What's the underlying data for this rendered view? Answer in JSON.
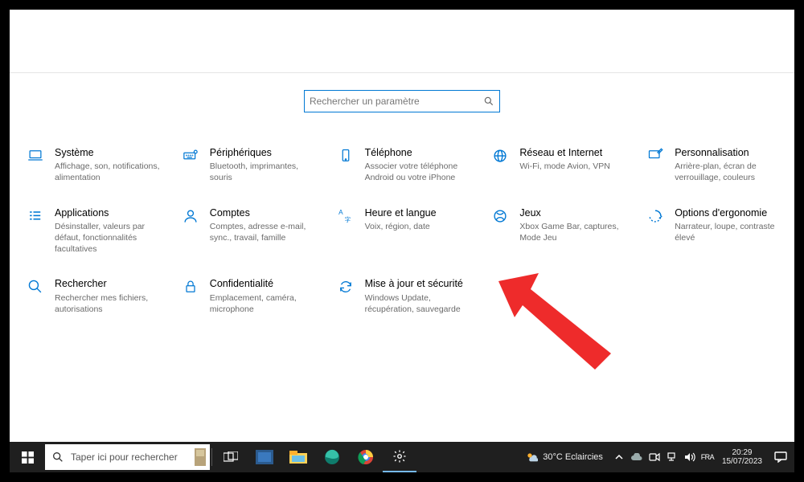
{
  "search": {
    "placeholder": "Rechercher un paramètre"
  },
  "tiles": [
    {
      "id": "system",
      "title": "Système",
      "sub": "Affichage, son, notifications, alimentation"
    },
    {
      "id": "devices",
      "title": "Périphériques",
      "sub": "Bluetooth, imprimantes, souris"
    },
    {
      "id": "phone",
      "title": "Téléphone",
      "sub": "Associer votre téléphone Android ou votre iPhone"
    },
    {
      "id": "network",
      "title": "Réseau et Internet",
      "sub": "Wi-Fi, mode Avion, VPN"
    },
    {
      "id": "personal",
      "title": "Personnalisation",
      "sub": "Arrière-plan, écran de verrouillage, couleurs"
    },
    {
      "id": "apps",
      "title": "Applications",
      "sub": "Désinstaller, valeurs par défaut, fonctionnalités facultatives"
    },
    {
      "id": "accounts",
      "title": "Comptes",
      "sub": "Comptes, adresse e-mail, sync., travail, famille"
    },
    {
      "id": "time",
      "title": "Heure et langue",
      "sub": "Voix, région, date"
    },
    {
      "id": "gaming",
      "title": "Jeux",
      "sub": "Xbox Game Bar, captures, Mode Jeu"
    },
    {
      "id": "ease",
      "title": "Options d'ergonomie",
      "sub": "Narrateur, loupe, contraste élevé"
    },
    {
      "id": "search-s",
      "title": "Rechercher",
      "sub": "Rechercher mes fichiers, autorisations"
    },
    {
      "id": "privacy",
      "title": "Confidentialité",
      "sub": "Emplacement, caméra, microphone"
    },
    {
      "id": "update",
      "title": "Mise à jour et sécurité",
      "sub": "Windows Update, récupération, sauvegarde"
    }
  ],
  "taskbar": {
    "search_placeholder": "Taper ici pour rechercher",
    "weather_temp": "30°C",
    "weather_text": "Eclaircies",
    "time": "20:29",
    "date": "15/07/2023"
  }
}
